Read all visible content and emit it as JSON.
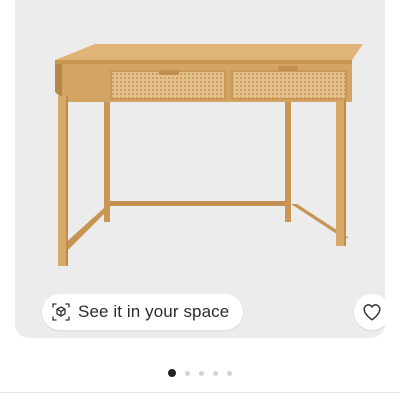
{
  "ar_button": {
    "label": "See it in your space",
    "icon": "ar-cube-icon"
  },
  "favorite_button": {
    "icon": "heart-outline-icon"
  },
  "carousel": {
    "total_images": 5,
    "active_index": 0
  },
  "colors": {
    "background": "#ececed",
    "wood": "#d2a464",
    "cane": "#e2c089",
    "active_dot": "#222222",
    "inactive_dot": "#d4d4d4"
  }
}
